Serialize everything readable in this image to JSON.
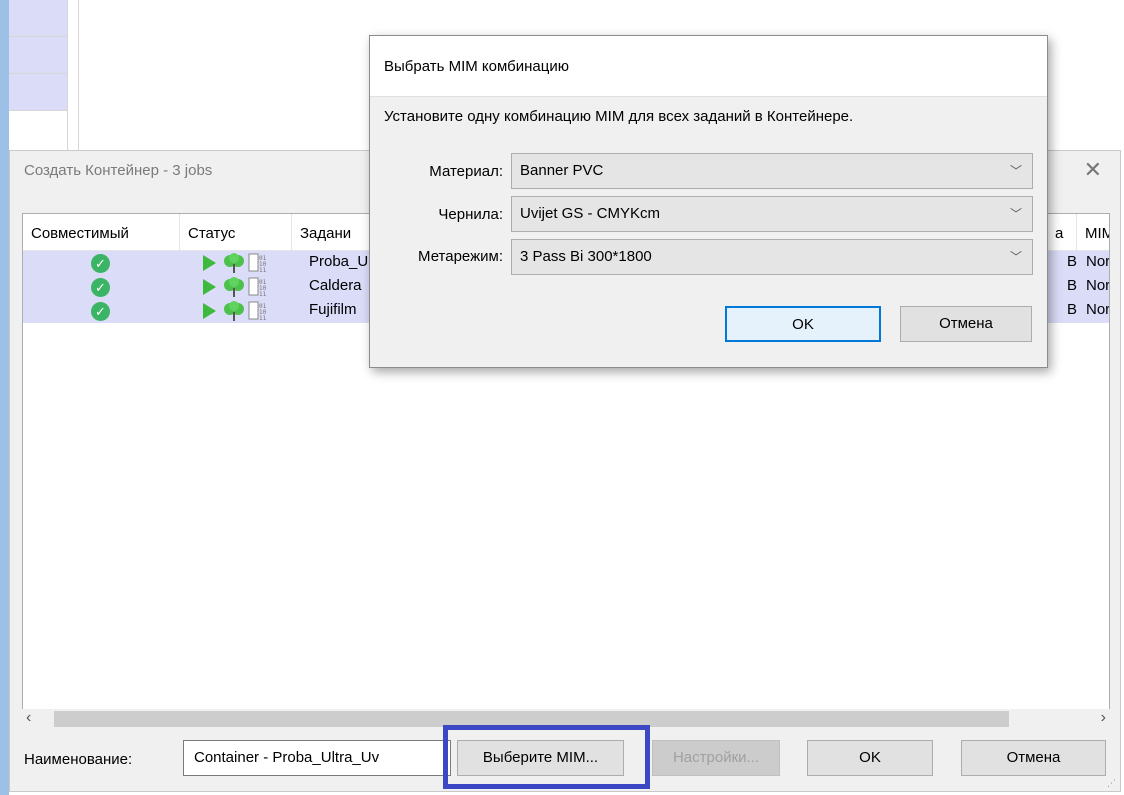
{
  "main_dialog": {
    "title": "Создать Контейнер - 3 jobs",
    "close_glyph": "✕",
    "columns": [
      "Совместимый",
      "Статус",
      "Задани",
      "a",
      "MIM"
    ],
    "rows": [
      {
        "job": "Proba_U",
        "b": "B",
        "mim": "Nor"
      },
      {
        "job": "Caldera",
        "b": "B",
        "mim": "Nor"
      },
      {
        "job": "Fujifilm",
        "b": "B",
        "mim": "Nor"
      }
    ],
    "scroll_left": "‹",
    "scroll_right": "›",
    "name_label": "Наименование:",
    "name_value": "Container - Proba_Ultra_Uv",
    "choose_mim_button": "Выберите MIM...",
    "settings_button": "Настройки...",
    "ok_button": "OK",
    "cancel_button": "Отмена",
    "highlight_color": "#3b47c4"
  },
  "mim_dialog": {
    "title": "Выбрать MIM комбинацию",
    "description": "Установите одну комбинацию MIM для всех заданий в Контейнере.",
    "material_label": "Материал:",
    "material_value": "Banner PVC",
    "ink_label": "Чернила:",
    "ink_value": "Uvijet GS - CMYKcm",
    "metamode_label": "Метарежим:",
    "metamode_value": "3 Pass Bi 300*1800",
    "ok_button": "OK",
    "cancel_button": "Отмена",
    "chevron": "﹀"
  },
  "icons": {
    "check": "check-circle-icon",
    "play": "play-icon",
    "tree": "tree-icon",
    "doc": "binary-file-icon"
  },
  "colors": {
    "row_selected": "#dadcf8",
    "check_green": "#3cb466",
    "focus_blue": "#0078d7"
  }
}
